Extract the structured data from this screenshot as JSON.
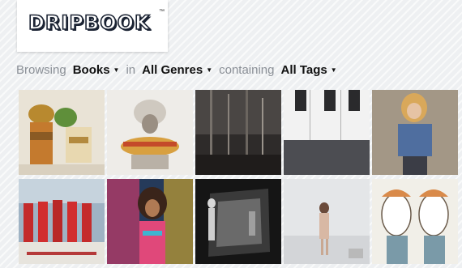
{
  "logo": {
    "text": "DRIPBOOK",
    "tm": "™"
  },
  "browse": {
    "browsing_label": "Browsing",
    "books_label": "Books",
    "in_label": "in",
    "genres_label": "All Genres",
    "containing_label": "containing",
    "tags_label": "All Tags"
  },
  "colors": {
    "dark_text": "#111111",
    "muted_text": "#8a8f96",
    "logo_outline": "#1b2333"
  },
  "icons": {
    "dropdown": "caret-down-icon"
  }
}
